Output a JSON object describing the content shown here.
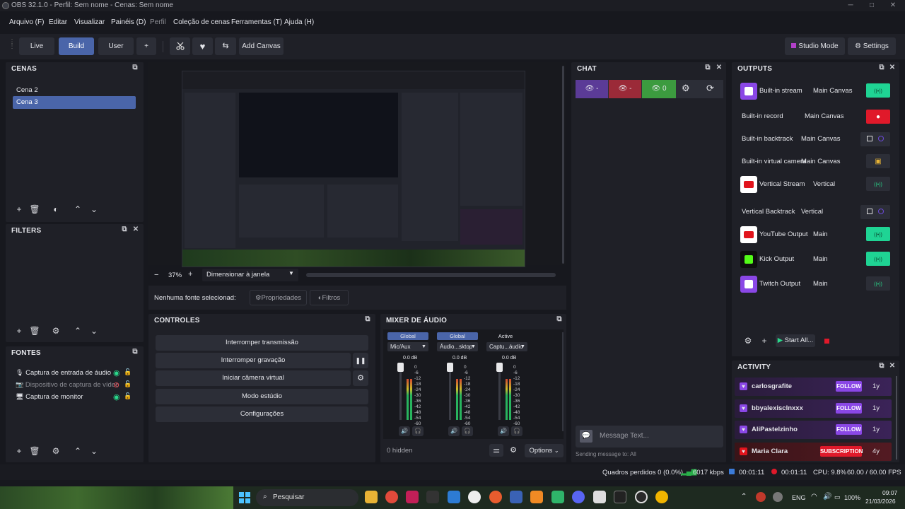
{
  "window": {
    "title": "OBS 32.1.0 - Perfil: Sem nome - Cenas: Sem nome",
    "minimize": "─",
    "maximize": "□",
    "close": "✕"
  },
  "menu": [
    "Arquivo (F)",
    "Editar",
    "Visualizar",
    "Painéis (D)",
    "Perfil",
    "Coleção de cenas",
    "Ferramentas (T)",
    "Ajuda (H)"
  ],
  "toolbar": {
    "live": "Live",
    "build": "Build",
    "user": "User",
    "add": "+",
    "add_canvas": "Add Canvas",
    "studio_mode": "Studio Mode",
    "settings": "Settings"
  },
  "scenes": {
    "title": "CENAS",
    "items": [
      "Cena 2",
      "Cena 3"
    ],
    "selected": 1
  },
  "filters": {
    "title": "FILTERS"
  },
  "sources": {
    "title": "FONTES",
    "items": [
      {
        "label": "Captura de entrada de áudio",
        "icon": "microphone-icon",
        "visible": true
      },
      {
        "label": "Dispositivo de captura de vídeo",
        "icon": "camera-icon",
        "visible": false
      },
      {
        "label": "Captura de monitor",
        "icon": "monitor-icon",
        "visible": true
      }
    ]
  },
  "preview": {
    "zoom": "37%",
    "minus": "−",
    "plus": "+",
    "scale_mode": "Dimensionar à janela",
    "no_source": "Nenhuma fonte selecionad:",
    "properties": "Propriedades",
    "filters": "Filtros"
  },
  "controls": {
    "title": "CONTROLES",
    "stop_stream": "Interromper transmissão",
    "stop_record": "Interromper gravação",
    "virtual_cam": "Iniciar câmera virtual",
    "studio_mode": "Modo estúdio",
    "settings": "Configurações"
  },
  "mixer": {
    "title": "MIXER DE ÁUDIO",
    "hidden": "0 hidden",
    "options": "Options",
    "channels": [
      {
        "tag": "Global",
        "name": "Mic/Aux",
        "db": "0.0 dB"
      },
      {
        "tag": "Global",
        "name": "Áudio...sktop",
        "db": "0.0 dB"
      },
      {
        "tag": "Active",
        "name": "Captu...áudio",
        "db": "0.0 dB"
      }
    ],
    "scale": [
      "0",
      "-6",
      "-12",
      "-18",
      "-24",
      "-30",
      "-36",
      "-42",
      "-48",
      "-54",
      "-60"
    ]
  },
  "chat": {
    "title": "CHAT",
    "pills": [
      {
        "text": "-",
        "color": "#5b3b97"
      },
      {
        "text": "-",
        "color": "#9b2a38"
      },
      {
        "text": "0",
        "color": "#3c9b3f"
      }
    ],
    "placeholder": "Message Text...",
    "sending": "Sending message to: All"
  },
  "outputs": {
    "title": "OUTPUTS",
    "start_all": "Start All...",
    "items": [
      {
        "name": "Built-in stream",
        "canvas": "Main Canvas",
        "logo": "twitch",
        "state": "live"
      },
      {
        "name": "Built-in record",
        "canvas": "Main Canvas",
        "logo": "",
        "state": "rec"
      },
      {
        "name": "Built-in backtrack",
        "canvas": "Main Canvas",
        "logo": "",
        "state": "backtrack"
      },
      {
        "name": "Built-in virtual camera",
        "canvas": "Main Canvas",
        "logo": "",
        "state": "vcam"
      },
      {
        "name": "Vertical Stream",
        "canvas": "Vertical",
        "logo": "youtube",
        "state": "idle"
      },
      {
        "name": "Vertical Backtrack",
        "canvas": "Vertical",
        "logo": "",
        "state": "backtrack"
      },
      {
        "name": "YouTube Output",
        "canvas": "Main",
        "logo": "youtube",
        "state": "live"
      },
      {
        "name": "Kick Output",
        "canvas": "Main",
        "logo": "kick",
        "state": "live"
      },
      {
        "name": "Twitch Output",
        "canvas": "Main",
        "logo": "twitch",
        "state": "idle"
      }
    ]
  },
  "activity": {
    "title": "ACTIVITY",
    "items": [
      {
        "user": "carlosgrafite",
        "badge": "FOLLOW",
        "age": "1y",
        "platform": "twitch"
      },
      {
        "user": "bbyalexisclnxxx",
        "badge": "FOLLOW",
        "age": "1y",
        "platform": "twitch"
      },
      {
        "user": "AliPastelzinho",
        "badge": "FOLLOW",
        "age": "1y",
        "platform": "twitch"
      },
      {
        "user": "Maria Clara",
        "badge": "SUBSCRIPTION",
        "age": "4y",
        "platform": "youtube"
      }
    ]
  },
  "status": {
    "dropped": "Quadros perdidos 0 (0.0%)",
    "kbps": "6017 kbps",
    "stream_time": "00:01:11",
    "rec_time": "00:01:11",
    "cpu": "CPU: 9.8%",
    "fps": "60.00 / 60.00 FPS"
  },
  "taskbar": {
    "search": "Pesquisar",
    "lang": "ENG",
    "battery": "100%",
    "time": "09:07",
    "date": "21/03/2026"
  },
  "colors": {
    "accent": "#4a65a9",
    "green": "#1fd494",
    "red": "#e0192a",
    "twitch": "#8a47e6",
    "youtube": "#e1141c",
    "kick": "#53fc18"
  }
}
